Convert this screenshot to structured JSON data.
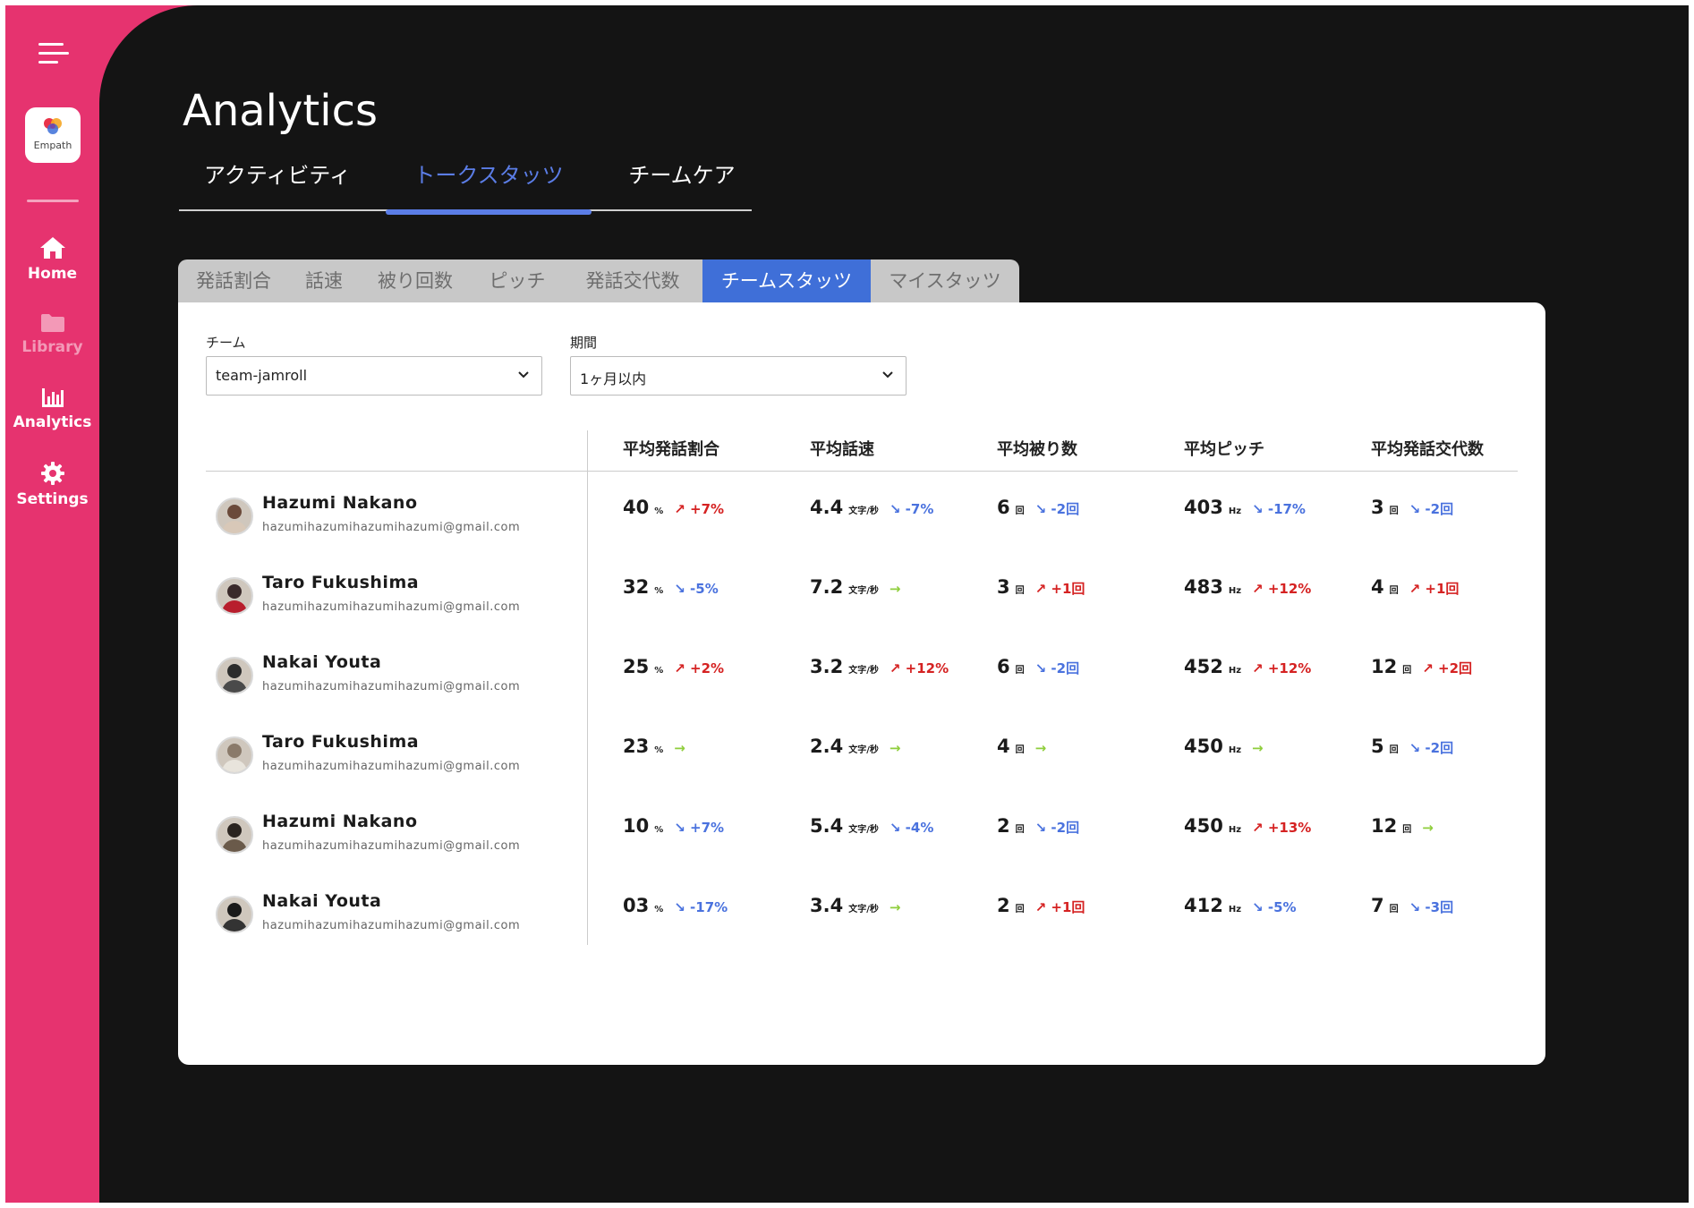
{
  "brand": {
    "logo_text": "Empath"
  },
  "sidebar": {
    "items": [
      {
        "label": "Home",
        "icon": "home-icon"
      },
      {
        "label": "Library",
        "icon": "folder-icon"
      },
      {
        "label": "Analytics",
        "icon": "bar-chart-icon"
      },
      {
        "label": "Settings",
        "icon": "gear-icon"
      }
    ]
  },
  "page": {
    "title": "Analytics"
  },
  "top_tabs": [
    {
      "label": "アクティビティ"
    },
    {
      "label": "トークスタッツ",
      "active": true
    },
    {
      "label": "チームケア"
    }
  ],
  "sub_tabs": [
    {
      "label": "発話割合"
    },
    {
      "label": "話速"
    },
    {
      "label": "被り回数"
    },
    {
      "label": "ピッチ"
    },
    {
      "label": "発話交代数"
    },
    {
      "label": "チームスタッツ",
      "active": true
    },
    {
      "label": "マイスタッツ"
    }
  ],
  "filters": {
    "team": {
      "label": "チーム",
      "value": "team-jamroll"
    },
    "period": {
      "label": "期間",
      "value": "1ヶ月以内"
    }
  },
  "table": {
    "columns": [
      "平均発話割合",
      "平均話速",
      "平均被り数",
      "平均ピッチ",
      "平均発話交代数"
    ],
    "units": [
      "%",
      "文字/秒",
      "回",
      "Hz",
      "回"
    ],
    "rows": [
      {
        "name": "Hazumi Nakano",
        "email": "hazumihazumihazumihazumi@gmail.com",
        "cells": [
          {
            "value": "40",
            "delta": "↗ +7%",
            "dir": "up"
          },
          {
            "value": "4.4",
            "delta": "↘ -7%",
            "dir": "down"
          },
          {
            "value": "6",
            "delta": "↘ -2回",
            "dir": "down"
          },
          {
            "value": "403",
            "delta": "↘ -17%",
            "dir": "down"
          },
          {
            "value": "3",
            "delta": "↘ -2回",
            "dir": "down"
          }
        ]
      },
      {
        "name": "Taro Fukushima",
        "email": "hazumihazumihazumihazumi@gmail.com",
        "cells": [
          {
            "value": "32",
            "delta": "↘ -5%",
            "dir": "down"
          },
          {
            "value": "7.2",
            "delta": "→",
            "dir": "flat"
          },
          {
            "value": "3",
            "delta": "↗ +1回",
            "dir": "up"
          },
          {
            "value": "483",
            "delta": "↗ +12%",
            "dir": "up"
          },
          {
            "value": "4",
            "delta": "↗ +1回",
            "dir": "up"
          }
        ]
      },
      {
        "name": "Nakai Youta",
        "email": "hazumihazumihazumihazumi@gmail.com",
        "cells": [
          {
            "value": "25",
            "delta": "↗ +2%",
            "dir": "up"
          },
          {
            "value": "3.2",
            "delta": "↗ +12%",
            "dir": "up"
          },
          {
            "value": "6",
            "delta": "↘ -2回",
            "dir": "down"
          },
          {
            "value": "452",
            "delta": "↗ +12%",
            "dir": "up"
          },
          {
            "value": "12",
            "delta": "↗ +2回",
            "dir": "up"
          }
        ]
      },
      {
        "name": "Taro Fukushima",
        "email": "hazumihazumihazumihazumi@gmail.com",
        "cells": [
          {
            "value": "23",
            "delta": "→",
            "dir": "flat"
          },
          {
            "value": "2.4",
            "delta": "→",
            "dir": "flat"
          },
          {
            "value": "4",
            "delta": "→",
            "dir": "flat"
          },
          {
            "value": "450",
            "delta": "→",
            "dir": "flat"
          },
          {
            "value": "5",
            "delta": "↘ -2回",
            "dir": "down"
          }
        ]
      },
      {
        "name": "Hazumi Nakano",
        "email": "hazumihazumihazumihazumi@gmail.com",
        "cells": [
          {
            "value": "10",
            "delta": "↘ +7%",
            "dir": "down"
          },
          {
            "value": "5.4",
            "delta": "↘ -4%",
            "dir": "down"
          },
          {
            "value": "2",
            "delta": "↘ -2回",
            "dir": "down"
          },
          {
            "value": "450",
            "delta": "↗ +13%",
            "dir": "up"
          },
          {
            "value": "12",
            "delta": "→",
            "dir": "flat"
          }
        ]
      },
      {
        "name": "Nakai Youta",
        "email": "hazumihazumihazumihazumi@gmail.com",
        "cells": [
          {
            "value": "03",
            "delta": "↘ -17%",
            "dir": "down"
          },
          {
            "value": "3.4",
            "delta": "→",
            "dir": "flat"
          },
          {
            "value": "2",
            "delta": "↗ +1回",
            "dir": "up"
          },
          {
            "value": "412",
            "delta": "↘ -5%",
            "dir": "down"
          },
          {
            "value": "7",
            "delta": "↘ -3回",
            "dir": "down"
          }
        ]
      }
    ]
  },
  "colors": {
    "sidebar": "#e6336f",
    "background": "#141414",
    "accent": "#5b7de6",
    "active_subtab": "#3f6fd8",
    "increase": "#d52222",
    "decrease": "#4a72de",
    "unchanged": "#8fce3c"
  }
}
